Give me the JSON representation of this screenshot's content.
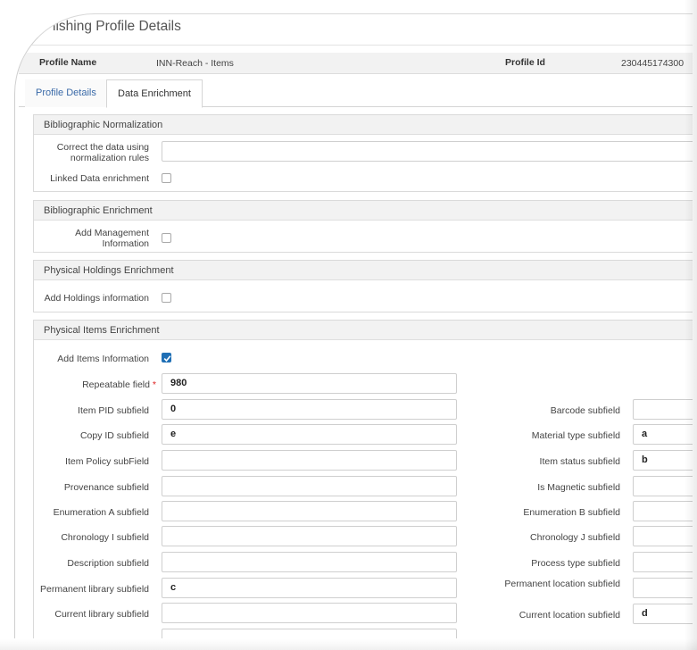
{
  "page": {
    "title": "lishing Profile Details"
  },
  "profile": {
    "name_label": "Profile Name",
    "name_value": "INN-Reach - Items",
    "id_label": "Profile Id",
    "id_value": "230445174300"
  },
  "tabs": [
    {
      "label": "Profile Details",
      "active": false
    },
    {
      "label": "Data Enrichment",
      "active": true
    }
  ],
  "sections": {
    "biblio_norm": {
      "title": "Bibliographic Normalization",
      "correct_label": "Correct the data using normalization rules",
      "correct_value": "",
      "linked_label": "Linked Data enrichment",
      "linked_checked": false
    },
    "biblio_enrich": {
      "title": "Bibliographic Enrichment",
      "mgmt_label": "Add Management Information",
      "mgmt_checked": false
    },
    "holdings": {
      "title": "Physical Holdings Enrichment",
      "add_label": "Add Holdings information",
      "add_checked": false
    },
    "items": {
      "title": "Physical Items Enrichment",
      "add_label": "Add Items Information",
      "add_checked": true,
      "repeatable_label": "Repeatable field",
      "repeatable_value": "980",
      "required_mark": "*",
      "left_fields": [
        {
          "label": "Item PID subfield",
          "value": "0"
        },
        {
          "label": "Copy ID subfield",
          "value": "e"
        },
        {
          "label": "Item Policy subField",
          "value": ""
        },
        {
          "label": "Provenance subfield",
          "value": ""
        },
        {
          "label": "Enumeration A subfield",
          "value": ""
        },
        {
          "label": "Chronology I subfield",
          "value": ""
        },
        {
          "label": "Description subfield",
          "value": ""
        },
        {
          "label": "Permanent library subfield",
          "value": "c"
        },
        {
          "label": "Current library subfield",
          "value": ""
        }
      ],
      "right_fields": [
        {
          "label": "Barcode subfield",
          "value": ""
        },
        {
          "label": "Material type subfield",
          "value": "a"
        },
        {
          "label": "Item status subfield",
          "value": "b"
        },
        {
          "label": "Is Magnetic subfield",
          "value": ""
        },
        {
          "label": "Enumeration B subfield",
          "value": ""
        },
        {
          "label": "Chronology J subfield",
          "value": ""
        },
        {
          "label": "Process type subfield",
          "value": ""
        },
        {
          "label": "Permanent location subfield",
          "value": ""
        },
        {
          "label": "Current location subfield",
          "value": "d"
        }
      ]
    }
  },
  "colors": {
    "accent": "#1f6fb5",
    "link": "#3a6aa8",
    "required": "#dd2222"
  }
}
